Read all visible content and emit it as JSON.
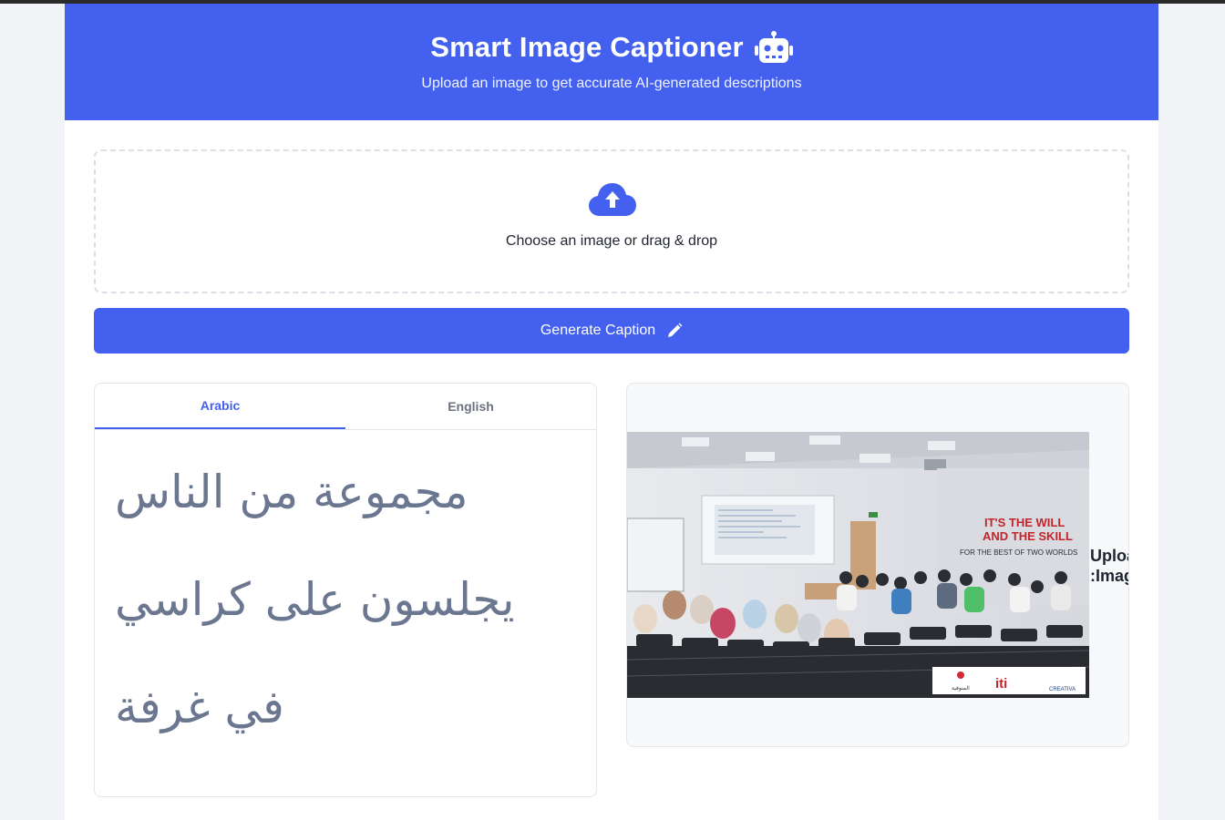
{
  "header": {
    "title": "Smart Image Captioner",
    "subtitle": "Upload an image to get accurate AI-generated descriptions",
    "icon": "robot-icon"
  },
  "upload": {
    "icon": "cloud-upload-icon",
    "prompt": "Choose an image or drag & drop"
  },
  "generate_button": {
    "label": "Generate Caption",
    "icon": "pencil-icon"
  },
  "caption": {
    "tabs": [
      {
        "label": "Arabic",
        "active": true
      },
      {
        "label": "English",
        "active": false
      }
    ],
    "text": "مجموعة من الناس يجلسون على كراسي في غرفة"
  },
  "preview": {
    "label_line1": "Uploaded",
    "label_line2": "Image:",
    "photo_text": {
      "slogan_line1": "IT'S THE WILL",
      "slogan_line2": "AND THE SKILL",
      "slogan_line3": "FOR THE BEST OF TWO WORLDS",
      "logo1": "المنوفية",
      "logo2": "iti",
      "logo3": "CREATIVA"
    }
  },
  "colors": {
    "accent": "#4361ee",
    "caption_text": "#6b7790",
    "background": "#f1f3f7"
  }
}
